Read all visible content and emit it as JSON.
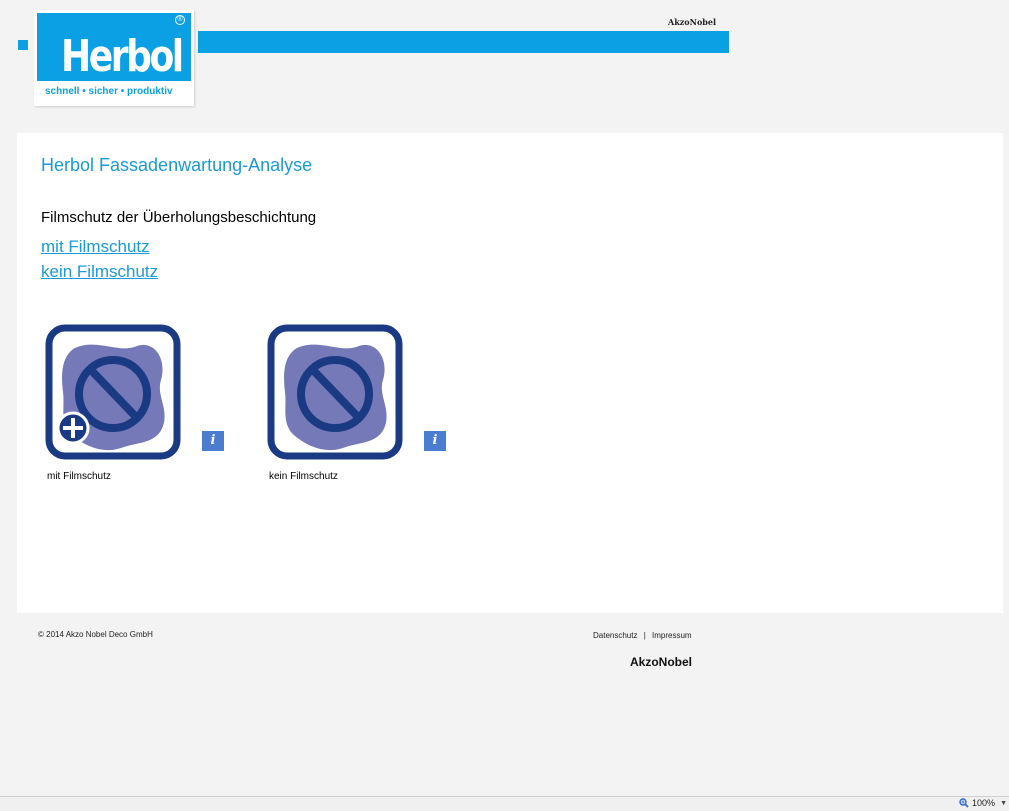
{
  "header": {
    "logo_text": "Herbol",
    "logo_tagline": "schnell • sicher • produktiv",
    "logo_registered": "®",
    "akzo_label": "AkzoNobel",
    "brand_color": "#0b9fe3"
  },
  "main": {
    "title": "Herbol Fassadenwartung-Analyse",
    "section_label": "Filmschutz der Überholungsbeschichtung",
    "links": [
      "mit Filmschutz",
      "kein Filmschutz"
    ],
    "options": [
      {
        "label": "mit Filmschutz",
        "icon": "film-protection-plus-icon",
        "info": "i"
      },
      {
        "label": "kein Filmschutz",
        "icon": "no-film-protection-icon",
        "info": "i"
      }
    ]
  },
  "footer": {
    "copyright": "© 2014 Akzo Nobel Deco GmbH",
    "privacy": "Datenschutz",
    "separator": "|",
    "imprint": "Impressum",
    "brand": "AkzoNobel"
  },
  "statusbar": {
    "zoom": "100%"
  },
  "colors": {
    "accent": "#1a9ad6",
    "icon_frame": "#1b3a84",
    "icon_blob": "#7579b8",
    "info_bg": "#4a7dd0"
  }
}
